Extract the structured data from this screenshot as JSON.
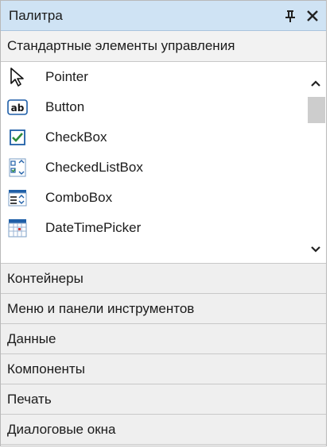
{
  "window": {
    "title": "Палитра",
    "pin_icon": "pin-icon",
    "close_icon": "close-icon"
  },
  "groups": {
    "standard": "Стандартные элементы управления",
    "containers": "Контейнеры",
    "menus": "Меню и панели инструментов",
    "data": "Данные",
    "components": "Компоненты",
    "printing": "Печать",
    "dialogs": "Диалоговые окна"
  },
  "tools": [
    {
      "label": "Pointer",
      "icon": "pointer-arrow-icon"
    },
    {
      "label": "Button",
      "icon": "button-ab-icon"
    },
    {
      "label": "CheckBox",
      "icon": "checkbox-icon"
    },
    {
      "label": "CheckedListBox",
      "icon": "checked-listbox-icon"
    },
    {
      "label": "ComboBox",
      "icon": "combobox-icon"
    },
    {
      "label": "DateTimePicker",
      "icon": "calendar-icon"
    }
  ],
  "colors": {
    "title_bar": "#cfe3f4",
    "group_header": "#efefef",
    "icon_blue": "#1f5fa8",
    "check_green": "#2c8a3a"
  }
}
